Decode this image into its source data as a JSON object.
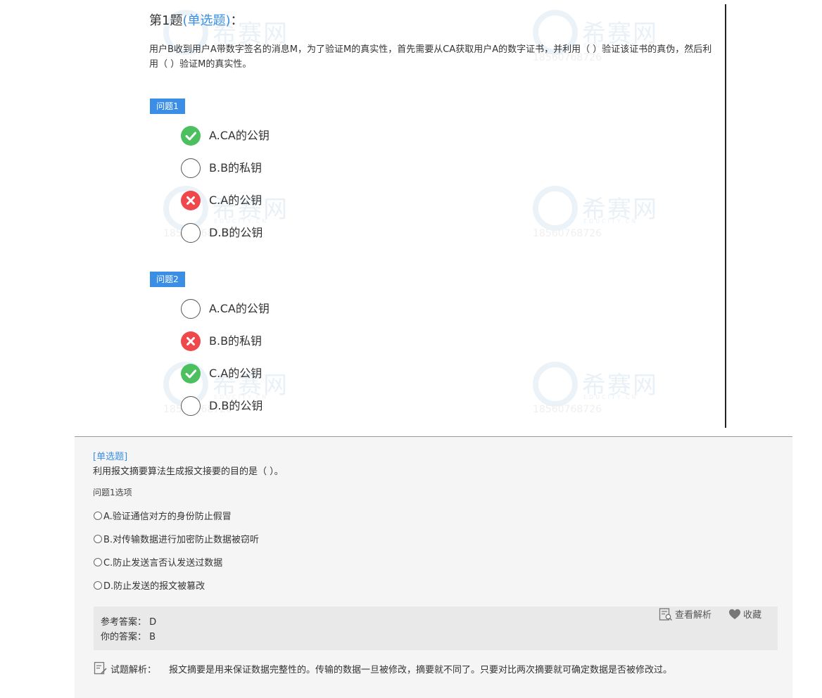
{
  "watermark": {
    "name": "希赛网",
    "en": "EDUCITY.CN",
    "phone": "18560768726"
  },
  "question": {
    "number_label": "第1题",
    "type_label": "(单选题)",
    "colon": "：",
    "text": "用户B收到用户A带数字签名的消息M，为了验证M的真实性，首先需要从CA获取用户A的数字证书，并利用（  ）验证该证书的真伪，然后利用（  ）验证M的真实性。"
  },
  "subquestions": [
    {
      "label": "问题1",
      "options": [
        {
          "text": "A.CA的公钥",
          "state": "correct"
        },
        {
          "text": "B.B的私钥",
          "state": "none"
        },
        {
          "text": "C.A的公钥",
          "state": "wrong"
        },
        {
          "text": "D.B的公钥",
          "state": "none"
        }
      ]
    },
    {
      "label": "问题2",
      "options": [
        {
          "text": "A.CA的公钥",
          "state": "none"
        },
        {
          "text": "B.B的私钥",
          "state": "wrong"
        },
        {
          "text": "C.A的公钥",
          "state": "correct"
        },
        {
          "text": "D.B的公钥",
          "state": "none"
        }
      ]
    }
  ],
  "panel": {
    "type_label": "[单选题]",
    "question": "利用报文摘要算法生成报文接要的目的是（ ）。",
    "sub_label": "问题1选项",
    "options": [
      "A.验证通信对方的身份防止假冒",
      "B.对传输数据进行加密防止数据被窃听",
      "C.防止发送言否认发送过数据",
      "D.防止发送的报文被篡改"
    ],
    "reference_label": "参考答案：",
    "reference_value": "D",
    "your_label": "你的答案：",
    "your_value": "B",
    "view_analysis": "查看解析",
    "favorite": "收藏",
    "analysis_label": "试题解析：",
    "analysis_text": "报文摘要是用来保证数据完整性的。传输的数据一旦被修改，摘要就不同了。只要对比两次摘要就可确定数据是否被修改过。"
  },
  "colors": {
    "accent": "#3a8ee6",
    "correct": "#4cbf5e",
    "wrong": "#f0474c"
  }
}
